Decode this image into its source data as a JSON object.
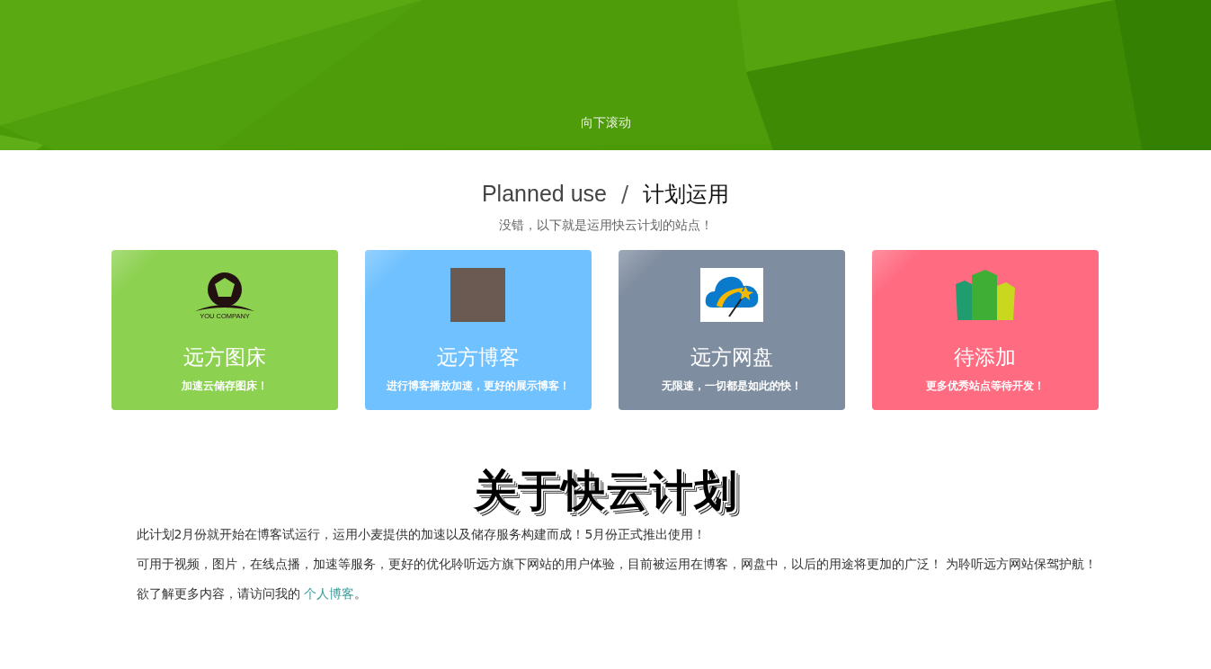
{
  "hero": {
    "scroll_hint": "向下滚动"
  },
  "section": {
    "title_en": "Planned use",
    "separator": "/",
    "title_zh": "计划运用",
    "subtitle": "没错，以下就是运用快云计划的站点！"
  },
  "cards": [
    {
      "kind": "logo",
      "logo_text": "YOU COMPANY",
      "title": "远方图床",
      "desc": "加速云储存图床！",
      "color": "#8cd150"
    },
    {
      "kind": "photo",
      "title": "远方博客",
      "desc": "进行博客播放加速，更好的展示博客！",
      "color": "#70c1ff"
    },
    {
      "kind": "cloud",
      "title": "远方网盘",
      "desc": "无限速，一切都是如此的快！",
      "color": "#7f8da0"
    },
    {
      "kind": "buildings",
      "title": "待添加",
      "desc": "更多优秀站点等待开发！",
      "color": "#ff6b81"
    }
  ],
  "about": {
    "title": "关于快云计划",
    "paragraphs": [
      {
        "text": "此计划2月份就开始在博客试运行，运用小麦提供的加速以及储存服务构建而成！5月份正式推出使用！"
      },
      {
        "text": "可用于视频，图片，在线点播，加速等服务，更好的优化聆听远方旗下网站的用户体验，目前被运用在博客，网盘中，以后的用途将更加的广泛！ 为聆听远方网站保驾护航！"
      },
      {
        "text": "欲了解更多内容，请访问我的 ",
        "link": "个人博客",
        "tail": "。"
      }
    ]
  }
}
